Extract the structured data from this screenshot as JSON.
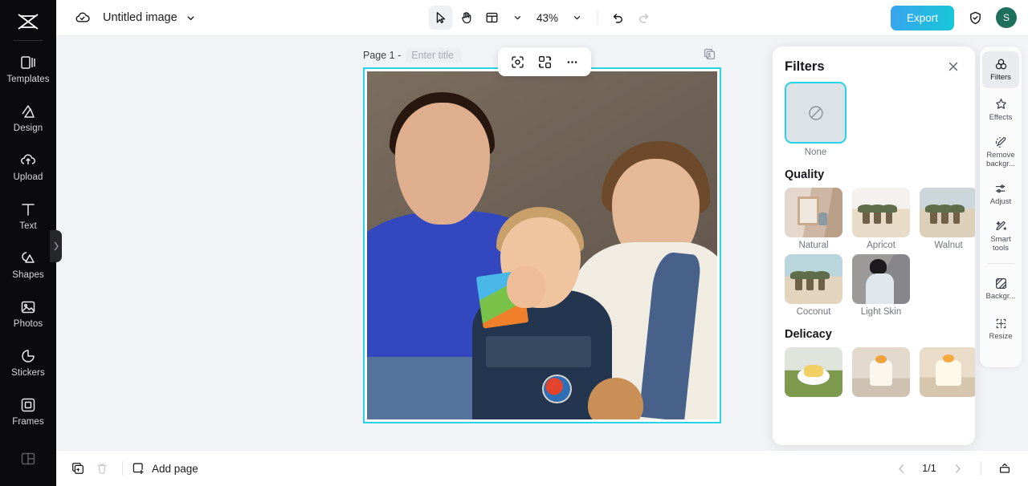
{
  "app": {
    "brand_icon": "capcut-logo-icon"
  },
  "left_sidebar": {
    "items": [
      {
        "label": "Templates",
        "icon": "templates-icon"
      },
      {
        "label": "Design",
        "icon": "design-icon"
      },
      {
        "label": "Upload",
        "icon": "upload-cloud-icon"
      },
      {
        "label": "Text",
        "icon": "text-icon"
      },
      {
        "label": "Shapes",
        "icon": "shapes-icon"
      },
      {
        "label": "Photos",
        "icon": "photos-icon"
      },
      {
        "label": "Stickers",
        "icon": "stickers-icon"
      },
      {
        "label": "Frames",
        "icon": "frames-icon"
      },
      {
        "label": "",
        "icon": "layout-grid-icon"
      }
    ],
    "collapse_handle_icon": "chevron-right-icon"
  },
  "topbar": {
    "cloud_icon": "cloud-saved-icon",
    "doc_title": "Untitled image",
    "title_caret_icon": "chevron-down-icon",
    "tools": {
      "select_icon": "cursor-arrow-icon",
      "hand_icon": "hand-pan-icon",
      "layout_icon": "page-layout-icon",
      "layout_caret_icon": "chevron-down-icon",
      "zoom_value": "43%",
      "zoom_caret_icon": "chevron-down-icon",
      "undo_icon": "undo-arrow-icon",
      "redo_icon": "redo-arrow-icon"
    },
    "export_label": "Export",
    "shield_icon": "shield-check-icon",
    "avatar_initial": "S"
  },
  "canvas": {
    "page_label": "Page 1 -",
    "page_title_value": "",
    "page_title_placeholder": "Enter title",
    "duplicate_page_icon": "duplicate-page-icon",
    "selection_color": "#25d4e8",
    "floating_toolbar": [
      {
        "icon": "crop-select-icon"
      },
      {
        "icon": "replace-image-icon"
      },
      {
        "icon": "more-options-icon"
      }
    ],
    "image_alt": "family-photo-man-woman-toddler"
  },
  "filters_panel": {
    "title": "Filters",
    "close_icon": "close-icon",
    "none": {
      "label": "None",
      "icon": "no-filter-icon",
      "selected": true
    },
    "sections": [
      {
        "title": "Quality",
        "items": [
          {
            "label": "Natural",
            "thumb": "th-room"
          },
          {
            "label": "Apricot",
            "thumb": "th-desert"
          },
          {
            "label": "Walnut",
            "thumb": "th-desert3"
          },
          {
            "label": "Coconut",
            "thumb": "th-desert4"
          },
          {
            "label": "Light Skin",
            "thumb": "th-skin"
          }
        ]
      },
      {
        "title": "Delicacy",
        "items": [
          {
            "label": "",
            "thumb": "th-cake1"
          },
          {
            "label": "",
            "thumb": "th-cake2"
          },
          {
            "label": "",
            "thumb": "th-cake3"
          }
        ]
      }
    ]
  },
  "right_rail": {
    "items": [
      {
        "label": "Filters",
        "icon": "filters-circles-icon",
        "active": true
      },
      {
        "label": "Effects",
        "icon": "effects-star-icon",
        "active": false
      },
      {
        "label": "Remove backgr...",
        "icon": "remove-background-icon",
        "active": false
      },
      {
        "label": "Adjust",
        "icon": "adjust-sliders-icon",
        "active": false
      },
      {
        "label": "Smart tools",
        "icon": "smart-tools-wand-icon",
        "active": false
      }
    ],
    "items2": [
      {
        "label": "Backgr...",
        "icon": "background-icon",
        "active": false
      },
      {
        "label": "Resize",
        "icon": "resize-icon",
        "active": false
      }
    ]
  },
  "bottombar": {
    "duplicate_icon": "duplicate-icon",
    "delete_icon": "trash-icon",
    "add_page_label": "Add page",
    "add_page_icon": "add-page-icon",
    "prev_icon": "chevron-left-icon",
    "page_indicator": "1/1",
    "next_icon": "chevron-right-icon",
    "presentation_icon": "present-icon"
  }
}
